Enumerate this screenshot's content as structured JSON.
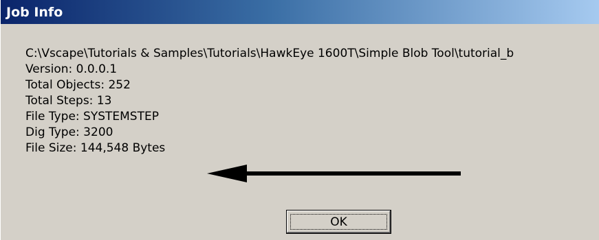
{
  "window": {
    "title": "Job Info"
  },
  "info": {
    "path": "C:\\Vscape\\Tutorials & Samples\\Tutorials\\HawkEye 1600T\\Simple Blob Tool\\tutorial_b",
    "version": "Version: 0.0.0.1",
    "total_objects": "Total Objects: 252",
    "total_steps": "Total Steps: 13",
    "file_type": "File Type: SYSTEMSTEP",
    "dig_type": "Dig Type: 3200",
    "file_size": "File Size: 144,548 Bytes"
  },
  "buttons": {
    "ok_label": "OK"
  },
  "annotation": {
    "arrow_icon": "left-arrow-icon",
    "arrow_color": "#000000"
  },
  "colors": {
    "dialog_background": "#d4d0c8",
    "titlebar_start": "#0a246a",
    "titlebar_end": "#a6caf0",
    "title_text": "#ffffff"
  }
}
